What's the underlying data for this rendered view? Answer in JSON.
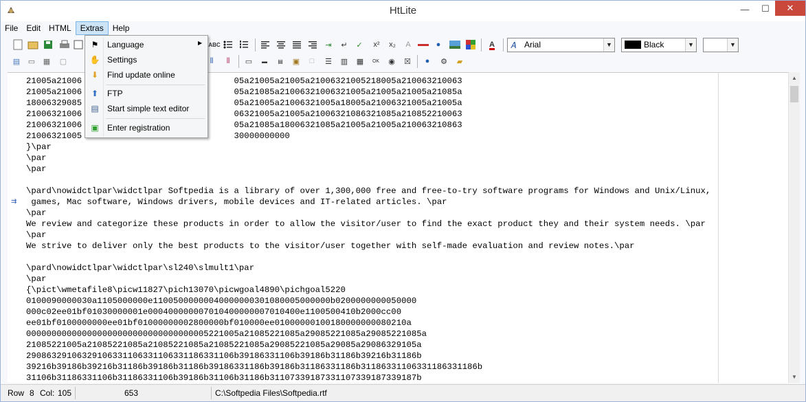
{
  "window": {
    "title": "HtLite",
    "close_glyph": "✕",
    "min_glyph": "—",
    "max_glyph": "☐"
  },
  "menubar": {
    "items": [
      "File",
      "Edit",
      "HTML",
      "Extras",
      "Help"
    ]
  },
  "extras_menu": {
    "items": [
      {
        "label": "Language",
        "icon": "flag-icon",
        "submenu": true
      },
      {
        "label": "Settings",
        "icon": "hand-settings-icon"
      },
      {
        "label": "Find update online",
        "icon": "download-arrow-icon"
      },
      {
        "label": "FTP",
        "icon": "ftp-upload-icon"
      },
      {
        "label": "Start simple text editor",
        "icon": "text-document-icon"
      },
      {
        "label": "Enter registration",
        "icon": "registration-icon"
      }
    ]
  },
  "toolbar": {
    "font_name": "Arial",
    "color_name": "Black",
    "size_value": "",
    "accent": "#cc0000"
  },
  "editor": {
    "lines": [
      "21005a21006                              05a21005a21005a21006321005218005a210063210063",
      "21005a21006                              05a21085a21006321006321005a21005a21005a21085a",
      "18006329085                              05a21005a21006321005a18005a21006321005a21005a",
      "21006321006                              06321005a21005a21006321086321085a210852210063",
      "21006321006                              05a21085a18006321085a21005a21005a210063210863",
      "21006321005                              30000000000",
      "}\\par",
      "\\par",
      "\\par",
      "",
      "\\pard\\nowidctlpar\\widctlpar Softpedia is a library of over 1,300,000 free and free-to-try software programs for Windows and Unix/Linux,",
      " games, Mac software, Windows drivers, mobile devices and IT-related articles. \\par",
      "\\par",
      "We review and categorize these products in order to allow the visitor/user to find the exact product they and their system needs. \\par",
      "\\par",
      "We strive to deliver only the best products to the visitor/user together with self-made evaluation and review notes.\\par",
      "",
      "\\pard\\nowidctlpar\\widctlpar\\sl240\\slmult1\\par",
      "\\par",
      "{\\pict\\wmetafile8\\picw11827\\pich13070\\picwgoal4890\\pichgoal5220",
      "0100090000030a1105000000e11005000000040000000301080005000000b0200000000050000",
      "000c02ee01bf01030000001e000400000007010400000007010400e1100500410b2000cc00",
      "ee01bf0100000000ee01bf01000000002800000bf010000ee01000000100180000000080210a",
      "000000000000000000000000000000000005221005a21085221085a29085221085a29085221085a",
      "21085221005a21085221085a21085221085a21085221085a29085221085a29085a29086329105a",
      "29086329106329106331106331106331186331106b39186331106b39186b31186b39216b31186b",
      "39216b39186b39216b31186b39186b31186b39186331186b39186b31186331186b31186331106331186331186b",
      "31106b31186331106b31186331106b39186b31106b31186b31107339187331107339187339187b"
    ]
  },
  "statusbar": {
    "row_label": "Row",
    "row_value": "8",
    "col_label": "Col:",
    "col_value": "105",
    "char_count": "653",
    "file_path": "C:\\Softpedia Files\\Softpedia.rtf"
  }
}
